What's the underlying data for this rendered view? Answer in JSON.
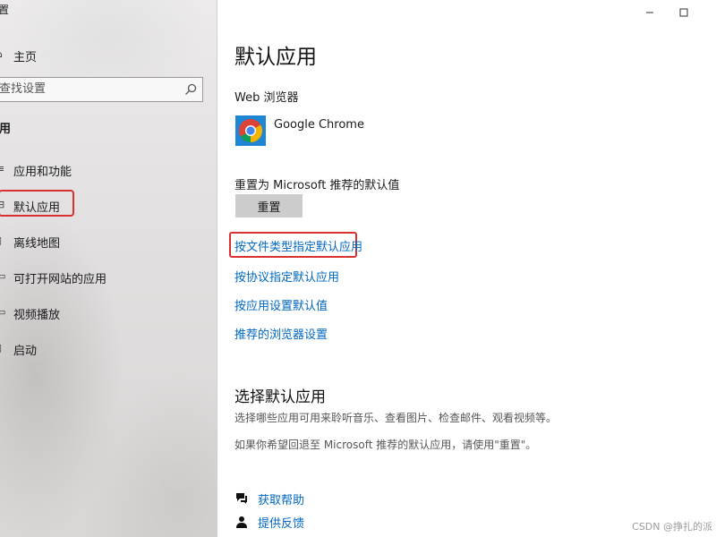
{
  "window": {
    "title": "置"
  },
  "sidebar": {
    "home_label": "主页",
    "search_placeholder": "查找设置",
    "section_header": "用",
    "items": [
      {
        "label": "应用和功能",
        "icon": "apps-features-icon"
      },
      {
        "label": "默认应用",
        "icon": "default-apps-icon",
        "selected": true
      },
      {
        "label": "离线地图",
        "icon": "offline-maps-icon"
      },
      {
        "label": "可打开网站的应用",
        "icon": "apps-for-websites-icon"
      },
      {
        "label": "视频播放",
        "icon": "video-playback-icon"
      },
      {
        "label": "启动",
        "icon": "startup-icon"
      }
    ]
  },
  "main": {
    "title": "默认应用",
    "web_browser_label": "Web 浏览器",
    "browser_name": "Google Chrome",
    "reset_label": "重置为 Microsoft 推荐的默认值",
    "reset_button": "重置",
    "links": [
      "按文件类型指定默认应用",
      "按协议指定默认应用",
      "按应用设置默认值",
      "推荐的浏览器设置"
    ],
    "section_title": "选择默认应用",
    "desc1": "选择哪些应用可用来聆听音乐、查看图片、检查邮件、观看视频等。",
    "desc2": "如果你希望回退至 Microsoft 推荐的默认应用，请使用\"重置\"。",
    "help_label": "获取帮助",
    "feedback_label": "提供反馈"
  },
  "watermark": "CSDN @挣扎的派",
  "colors": {
    "link": "#0067c0",
    "highlight_border": "#d93030",
    "reset_button_bg": "#cccccc",
    "app_icon_bg": "#1e86d4"
  }
}
